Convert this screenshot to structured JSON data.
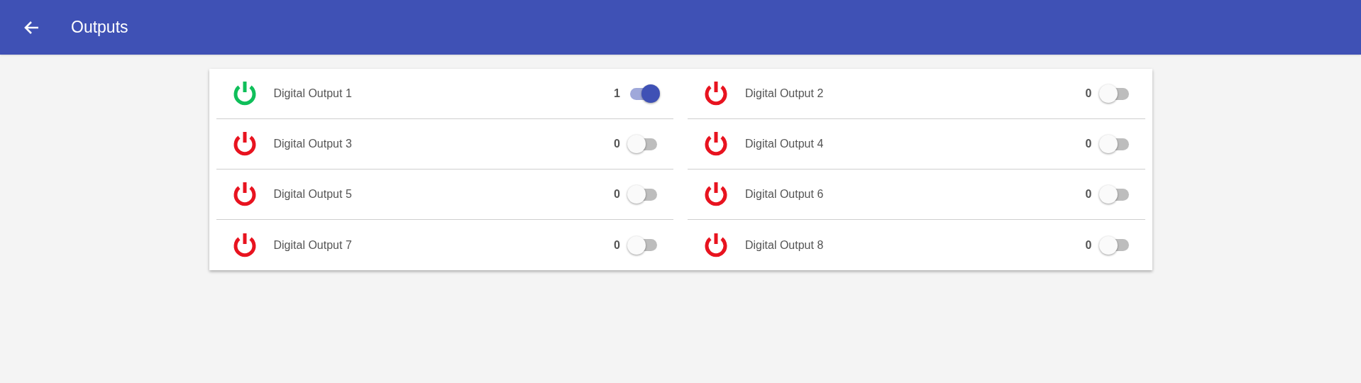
{
  "app_bar": {
    "title": "Outputs"
  },
  "outputs": [
    {
      "label": "Digital Output 1",
      "value": "1",
      "on": true
    },
    {
      "label": "Digital Output 2",
      "value": "0",
      "on": false
    },
    {
      "label": "Digital Output 3",
      "value": "0",
      "on": false
    },
    {
      "label": "Digital Output 4",
      "value": "0",
      "on": false
    },
    {
      "label": "Digital Output 5",
      "value": "0",
      "on": false
    },
    {
      "label": "Digital Output 6",
      "value": "0",
      "on": false
    },
    {
      "label": "Digital Output 7",
      "value": "0",
      "on": false
    },
    {
      "label": "Digital Output 8",
      "value": "0",
      "on": false
    }
  ]
}
